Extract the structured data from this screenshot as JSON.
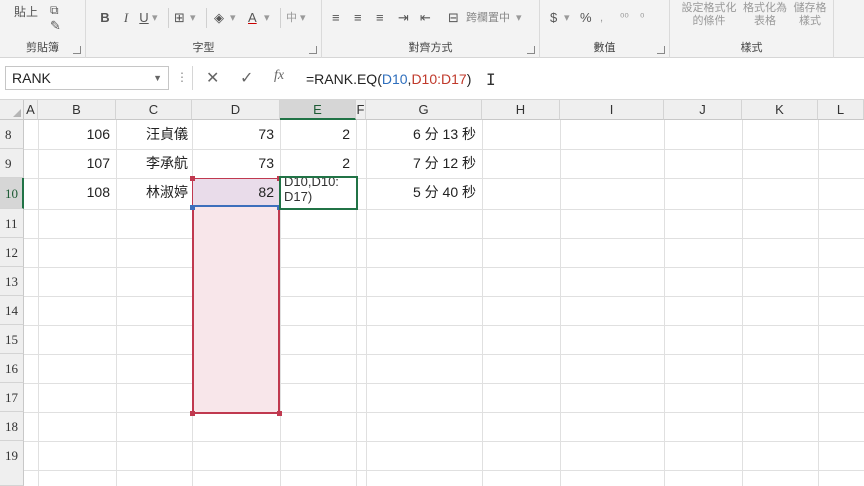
{
  "ribbon": {
    "clipboard": {
      "label": "剪貼簿",
      "paste_label": "貼上"
    },
    "font": {
      "label": "字型",
      "bold": "B",
      "italic": "I",
      "underline": "U",
      "font_color": "A"
    },
    "alignment": {
      "label": "對齊方式",
      "merge_center": "跨欄置中"
    },
    "number": {
      "label": "數值",
      "currency": "$",
      "percent": "%"
    },
    "styles": {
      "label": "樣式",
      "conditional_format": [
        "設定格式化",
        "的條件"
      ],
      "format_as_table": [
        "格式化為",
        "表格"
      ],
      "cell_styles": [
        "儲存格",
        "樣式"
      ]
    }
  },
  "formula_bar": {
    "name_box": "RANK",
    "formula_prefix": "=RANK.EQ(",
    "formula_ref1": "D10",
    "formula_comma": ",",
    "formula_ref2": "D10:D17",
    "formula_suffix": ")"
  },
  "columns": [
    "A",
    "B",
    "C",
    "D",
    "E",
    "F",
    "G",
    "H",
    "I",
    "J",
    "K",
    "L"
  ],
  "selected_column": "E",
  "rows": [
    "8",
    "9",
    "10",
    "11",
    "12",
    "13",
    "14",
    "15",
    "16",
    "17",
    "18",
    "19"
  ],
  "selected_row": "10",
  "data_rows": [
    {
      "row": "8",
      "b": "106",
      "c": "汪貞儀",
      "d": "73",
      "e": "2",
      "g": "6 分 13 秒"
    },
    {
      "row": "9",
      "b": "107",
      "c": "李承航",
      "d": "73",
      "e": "2",
      "g": "7 分 12 秒"
    },
    {
      "row": "10",
      "b": "108",
      "c": "林淑婷",
      "d": "82",
      "e": "",
      "g": "5 分 40 秒"
    }
  ],
  "edit_cell": {
    "line1": "D10,D10:",
    "line2": "D17)"
  }
}
